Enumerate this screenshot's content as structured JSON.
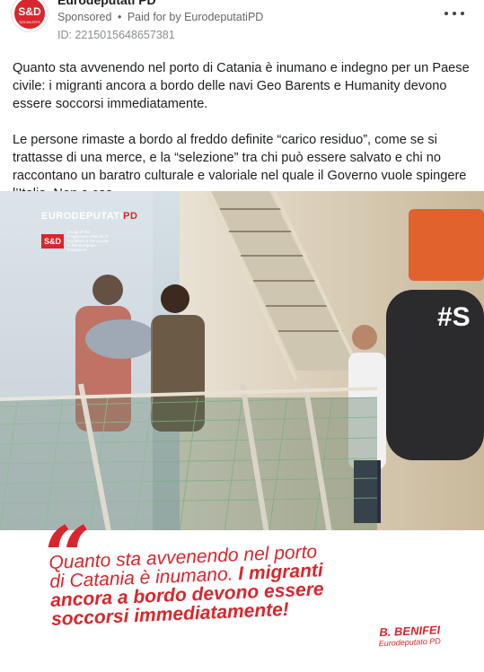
{
  "post": {
    "page_name": "Eurodeputati PD",
    "sponsored_label": "Sponsored",
    "separator": "•",
    "paid_for_prefix": "Paid for by",
    "payer": "EurodeputatiPD",
    "ad_id": "ID: 2215015648657381",
    "body_paragraphs": [
      "Quanto sta avvenendo nel porto di Catania è inumano e indegno per un Paese civile: i migranti ancora a bordo delle navi Geo Barents e Humanity devono essere soccorsi immediatamente.",
      "Le persone rimaste a bordo al freddo definite “carico residuo”, come se si trattasse di una merce, e la “selezione” tra chi può essere salvato e chi no raccontano un baratro culturale e valoriale nel quale il Governo vuole spingere l’Italia. Non a cas…"
    ]
  },
  "avatar": {
    "label": "S&D",
    "sub": "SOCIALISTS"
  },
  "creative": {
    "brand_euro": "EURODEPUTATI",
    "brand_pd": "PD",
    "brand_sd": "S&D",
    "brand_sd_text": "Group of the Progressive Alliance of Socialists & Democrats in the European Parliament",
    "quote_mark": "“",
    "quote_line1": "Quanto sta avvenendo nel porto",
    "quote_line2_light": "di Catania è inumano.",
    "quote_line2_bold": " I migranti",
    "quote_line3": "ancora a bordo devono essere",
    "quote_line4": "soccorsi immediatamente!",
    "signature_name": "B. BENIFEI",
    "signature_role": "Eurodeputato PD",
    "ship_mark": "#S"
  },
  "colors": {
    "accent": "#d9262c",
    "meta": "#65676b",
    "text": "#1c1e21"
  },
  "icons": {
    "more": "more-dots-icon"
  }
}
